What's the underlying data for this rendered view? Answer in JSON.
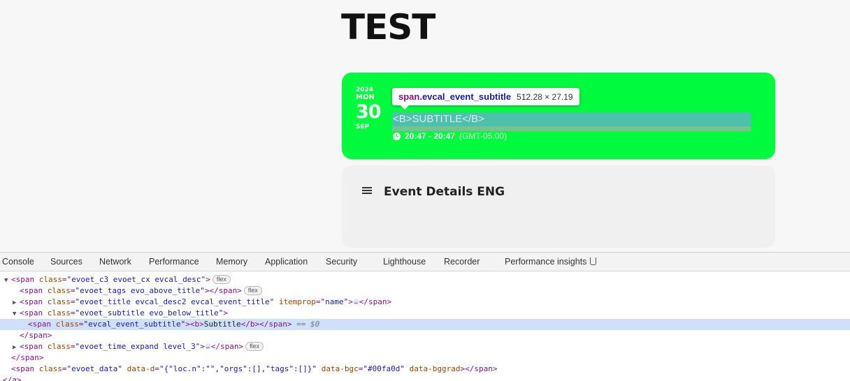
{
  "page": {
    "title": "TEST"
  },
  "event": {
    "year": "2024",
    "weekday": "MON",
    "day": "30",
    "month": "SEP",
    "subtitle": "<B>SUBTITLE</B>",
    "time": "20:47 - 20:47",
    "timezone": "(GMT-05:00)",
    "accent_color": "#00fa3d"
  },
  "tooltip": {
    "tag": "span",
    "class_name": ".evcal_event_subtitle",
    "size": "512.28 × 27.19"
  },
  "details": {
    "title": "Event Details ENG",
    "icon": "list-lines-icon"
  },
  "devtools": {
    "tabs": [
      "Console",
      "Sources",
      "Network",
      "Performance",
      "Memory",
      "Application",
      "Security",
      "Lighthouse",
      "Recorder",
      "Performance insights"
    ],
    "lines": [
      {
        "indent": 0,
        "tri": "▼",
        "open": "<span",
        "attr": "class",
        "val": "\"evoet_c3 evoet_cx evcal_desc\"",
        "rest": ">",
        "badge": "flex"
      },
      {
        "indent": 1,
        "tri": "",
        "open": "<span",
        "attr": "class",
        "val": "\"evoet_tags evo_above_title\"",
        "rest": "></span>",
        "badge": "flex"
      },
      {
        "indent": 1,
        "tri": "▶",
        "open": "<span",
        "attr": "class",
        "val": "\"evoet_title evcal_desc2 evcal_event_title\"",
        "attr2": "itemprop",
        "val2": "\"name\"",
        "rest": ">",
        "ellip": "…",
        "close": "</span>"
      },
      {
        "indent": 1,
        "tri": "▼",
        "open": "<span",
        "attr": "class",
        "val": "\"evoet_subtitle evo_below_title\"",
        "rest": ">"
      },
      {
        "indent": 2,
        "tri": "",
        "open": "<span",
        "attr": "class",
        "val": "\"evcal_event_subtitle\"",
        "rest": "><b>",
        "text": "Subtitle",
        "close": "</b></span>",
        "eq": "== $0"
      },
      {
        "indent": 1,
        "tri": "",
        "close_only": "</span>"
      },
      {
        "indent": 1,
        "tri": "▶",
        "open": "<span",
        "attr": "class",
        "val": "\"evoet_time_expand level_3\"",
        "rest": ">",
        "ellip": "…",
        "close": "</span>",
        "badge": "flex"
      },
      {
        "indent": 0,
        "tri": "",
        "close_only": "</span>"
      },
      {
        "indent": 0,
        "tri": "",
        "open": "<span",
        "attr": "class",
        "val": "\"evoet_data\"",
        "attr2": "data-d",
        "val2": "\"{\"loc.n\":\"\",\"orgs\":[],\"tags\":[]}\"",
        "attr3": "data-bgc",
        "val3": "\"#00fa0d\"",
        "attr4": "data-bggrad",
        "rest": "></span>"
      },
      {
        "indent": -1,
        "tri": "",
        "close_only": "</a>"
      }
    ]
  }
}
